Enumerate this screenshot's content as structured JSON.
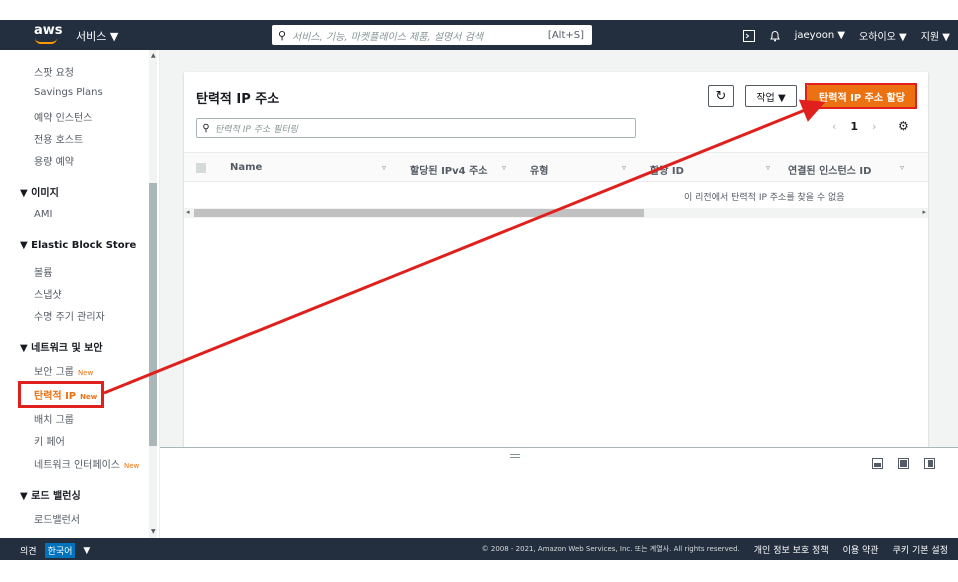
{
  "topnav": {
    "logo": "aws",
    "services": "서비스 ▼",
    "search_placeholder": "서비스, 기능, 마켓플레이스 제품, 설명서 검색",
    "search_shortcut": "[Alt+S]",
    "user": "jaeyoon ▼",
    "region": "오하이오 ▼",
    "support": "지원 ▼"
  },
  "sidebar": {
    "items": [
      {
        "label": "스팟 요청"
      },
      {
        "label": "Savings Plans"
      },
      {
        "label": "예약 인스턴스"
      },
      {
        "label": "전용 호스트"
      },
      {
        "label": "용량 예약"
      }
    ],
    "group_images": "▼ 이미지",
    "images_items": [
      {
        "label": "AMI"
      }
    ],
    "group_ebs": "▼ Elastic Block Store",
    "ebs_items": [
      {
        "label": "볼륨"
      },
      {
        "label": "스냅샷"
      },
      {
        "label": "수명 주기 관리자"
      }
    ],
    "group_network": "▼ 네트워크 및 보안",
    "network_items": [
      {
        "label": "보안 그룹",
        "badge": "New"
      },
      {
        "label": "탄력적 IP",
        "badge": "New"
      },
      {
        "label": "배치 그룹"
      },
      {
        "label": "키 페어"
      },
      {
        "label": "네트워크 인터페이스",
        "badge": "New"
      }
    ],
    "group_lb": "▼ 로드 밸런싱",
    "lb_items": [
      {
        "label": "로드밸런서"
      }
    ]
  },
  "panel": {
    "title": "탄력적 IP 주소",
    "refresh_icon": "↻",
    "actions_label": "작업 ▼",
    "allocate_label": "탄력적 IP 주소 할당",
    "filter_placeholder": "탄력적 IP 주소 필터링",
    "page_prev": "‹",
    "page_num": "1",
    "page_next": "›",
    "settings_icon": "⚙",
    "columns": [
      "Name",
      "할당된 IPv4 주소",
      "유형",
      "할당 ID",
      "연결된 인스턴스 ID"
    ],
    "empty_message": "이 리전에서 탄력적 IP 주소를 찾을 수 없음"
  },
  "footer": {
    "feedback": "의견",
    "language": "한국어",
    "lang_caret": "▼",
    "copyright": "© 2008 - 2021, Amazon Web Services, Inc. 또는 계열사. All rights reserved.",
    "privacy": "개인 정보 보호 정책",
    "terms": "이용 약관",
    "cookies": "쿠키 기본 설정"
  },
  "colors": {
    "nav_bg": "#232f3e",
    "accent": "#ec7211",
    "annotation": "#e0201c"
  }
}
